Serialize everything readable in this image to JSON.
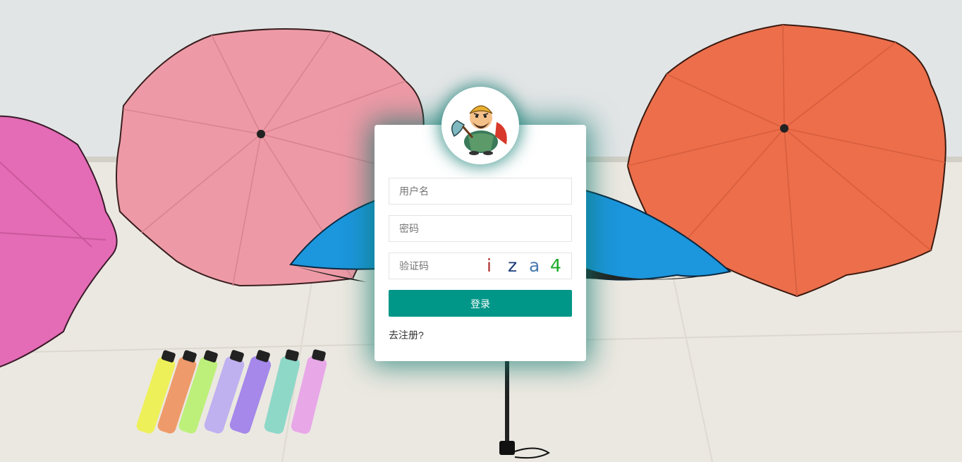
{
  "login": {
    "username_placeholder": "用户名",
    "password_placeholder": "密码",
    "captcha_placeholder": "验证码",
    "captcha_chars": [
      "i",
      "z",
      "a",
      "4"
    ],
    "captcha_colors": [
      "#b03030",
      "#1a3a7a",
      "#4a7ab0",
      "#1aaa2a"
    ],
    "submit_label": "登录",
    "register_link": "去注册?"
  },
  "colors": {
    "accent": "#009688",
    "glow": "#0c786e"
  },
  "icons": {
    "avatar": "cartoon-warrior-avatar"
  }
}
